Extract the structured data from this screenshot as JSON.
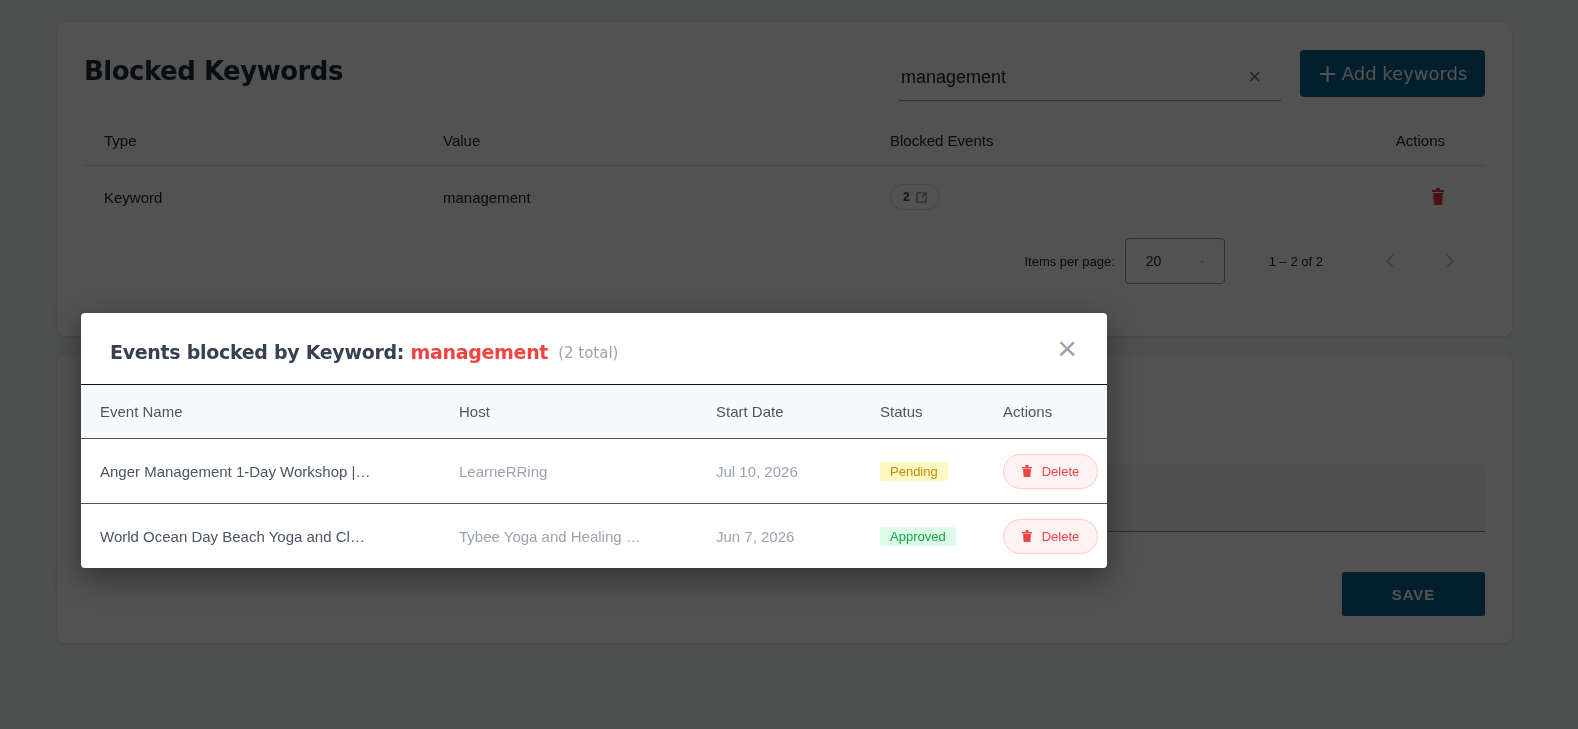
{
  "page": {
    "title": "Blocked Keywords",
    "search": {
      "value": "management",
      "clear_icon": "×"
    },
    "add_button": {
      "icon": "+",
      "label": "Add keywords"
    },
    "table": {
      "columns": [
        "Type",
        "Value",
        "Blocked Events",
        "Actions"
      ],
      "rows": [
        {
          "type": "Keyword",
          "value": "management",
          "blocked_events": "2"
        }
      ]
    },
    "pagination": {
      "label": "Items per page:",
      "page_size": "20",
      "range": "1 – 2 of 2"
    },
    "save_button": "SAVE"
  },
  "dialog": {
    "title": "Events blocked by Keyword:",
    "keyword": "management",
    "total": "(2 total)",
    "close": "×",
    "columns": [
      "Event Name",
      "Host",
      "Start Date",
      "Status",
      "Actions"
    ],
    "rows": [
      {
        "event": "Anger Management 1-Day Workshop |…",
        "host": "LearneRRing",
        "date": "Jul 10, 2026",
        "status": "Pending",
        "kind": "pending",
        "action": "Delete"
      },
      {
        "event": "World Ocean Day Beach Yoga and Cl…",
        "host": "Tybee Yoga and Healing …",
        "date": "Jun 7, 2026",
        "status": "Approved",
        "kind": "approved",
        "action": "Delete"
      }
    ]
  }
}
